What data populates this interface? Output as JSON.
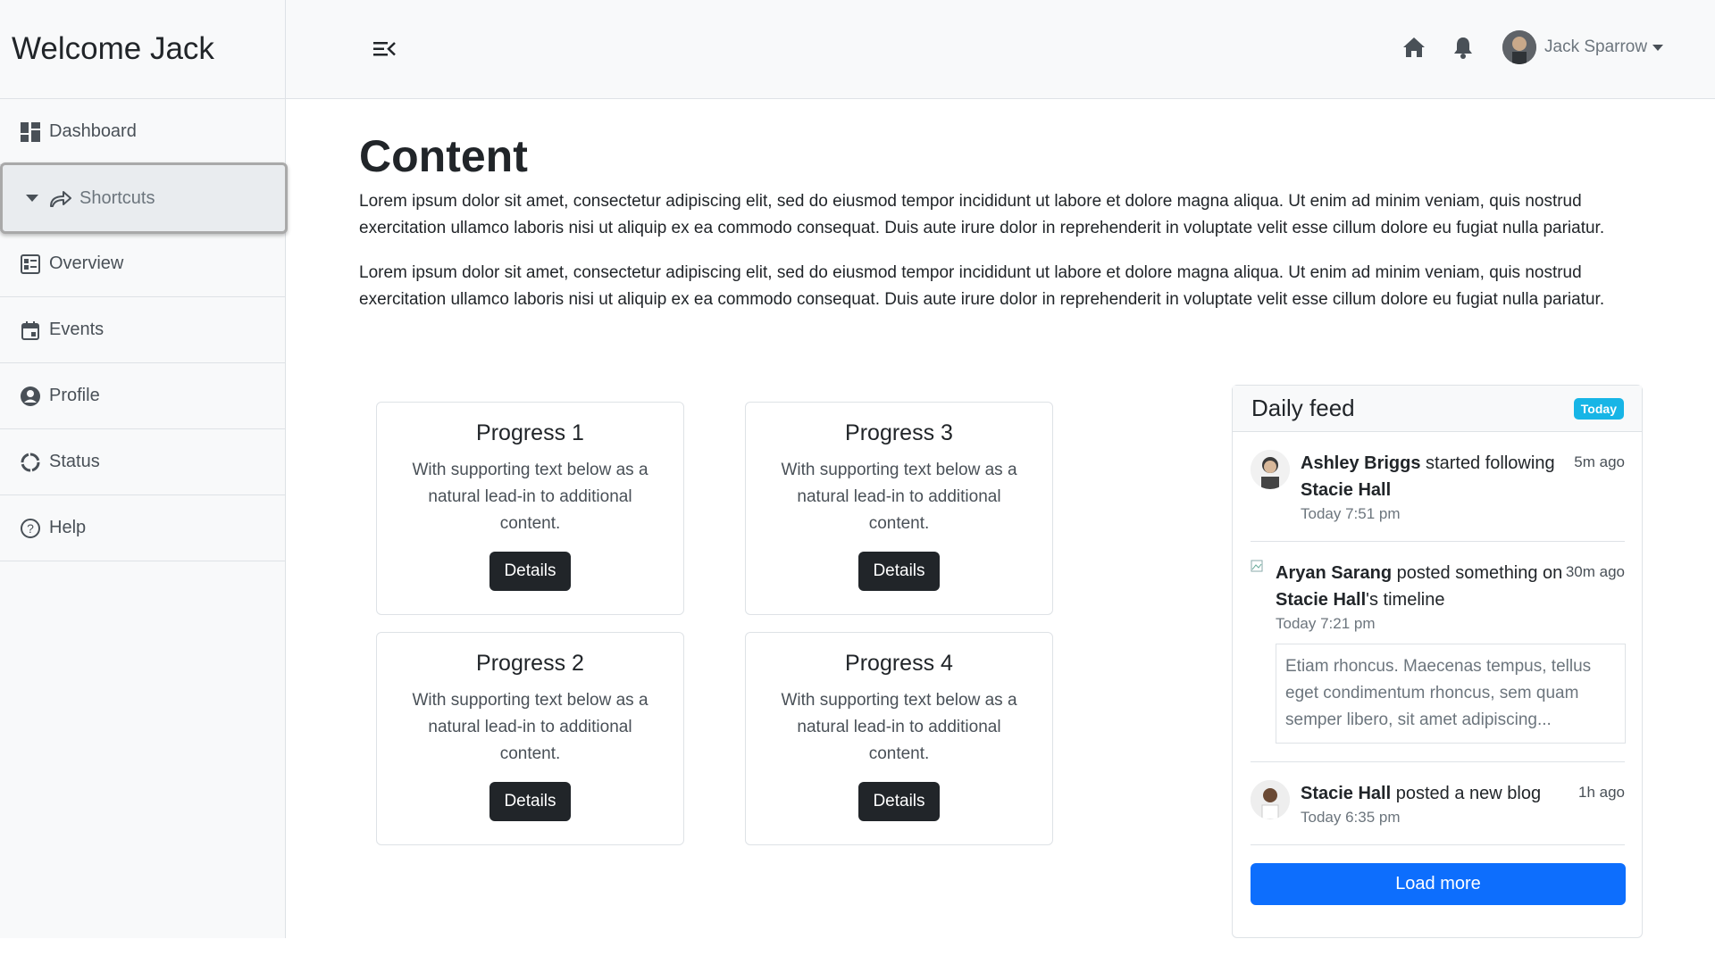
{
  "brand": {
    "title": "Welcome Jack"
  },
  "sidebar": {
    "items": [
      {
        "label": "Dashboard",
        "icon": "dashboard-icon"
      },
      {
        "label": "Shortcuts",
        "icon": "share-arrow-icon"
      },
      {
        "label": "Overview",
        "icon": "overview-icon"
      },
      {
        "label": "Events",
        "icon": "calendar-icon"
      },
      {
        "label": "Profile",
        "icon": "user-circle-icon"
      },
      {
        "label": "Status",
        "icon": "status-ring-icon"
      },
      {
        "label": "Help",
        "icon": "help-circle-icon"
      }
    ]
  },
  "header": {
    "user_name": "Jack Sparrow",
    "icons": [
      "menu-toggle-icon",
      "home-icon",
      "bell-icon"
    ]
  },
  "main": {
    "title": "Content",
    "paragraphs": [
      "Lorem ipsum dolor sit amet, consectetur adipiscing elit, sed do eiusmod tempor incididunt ut labore et dolore magna aliqua. Ut enim ad minim veniam, quis nostrud exercitation ullamco laboris nisi ut aliquip ex ea commodo consequat. Duis aute irure dolor in reprehenderit in voluptate velit esse cillum dolore eu fugiat nulla pariatur.",
      "Lorem ipsum dolor sit amet, consectetur adipiscing elit, sed do eiusmod tempor incididunt ut labore et dolore magna aliqua. Ut enim ad minim veniam, quis nostrud exercitation ullamco laboris nisi ut aliquip ex ea commodo consequat. Duis aute irure dolor in reprehenderit in voluptate velit esse cillum dolore eu fugiat nulla pariatur."
    ]
  },
  "cards": [
    {
      "title": "Progress 1",
      "text": "With supporting text below as a natural lead-in to additional content.",
      "button": "Details"
    },
    {
      "title": "Progress 3",
      "text": "With supporting text below as a natural lead-in to additional content.",
      "button": "Details"
    },
    {
      "title": "Progress 2",
      "text": "With supporting text below as a natural lead-in to additional content.",
      "button": "Details"
    },
    {
      "title": "Progress 4",
      "text": "With supporting text below as a natural lead-in to additional content.",
      "button": "Details"
    }
  ],
  "feed": {
    "title": "Daily feed",
    "badge": "Today",
    "entries": [
      {
        "actor": "Ashley Briggs",
        "action": " started following ",
        "target": "Stacie Hall",
        "suffix": "",
        "ago": "5m ago",
        "when": "Today 7:51 pm"
      },
      {
        "actor": "Aryan Sarang",
        "action": " posted something on ",
        "target": "Stacie Hall",
        "suffix": "'s timeline",
        "ago": "30m ago",
        "when": "Today 7:21 pm",
        "quote": "Etiam rhoncus. Maecenas tempus, tellus eget condimentum rhoncus, sem quam semper libero, sit amet adipiscing..."
      },
      {
        "actor": "Stacie Hall",
        "action": " posted a new blog",
        "target": "",
        "suffix": "",
        "ago": "1h ago",
        "when": "Today 6:35 pm"
      }
    ],
    "load_more": "Load more"
  },
  "colors": {
    "primary": "#0d6efd",
    "badge": "#17b5e6",
    "dark_button": "#212529"
  }
}
